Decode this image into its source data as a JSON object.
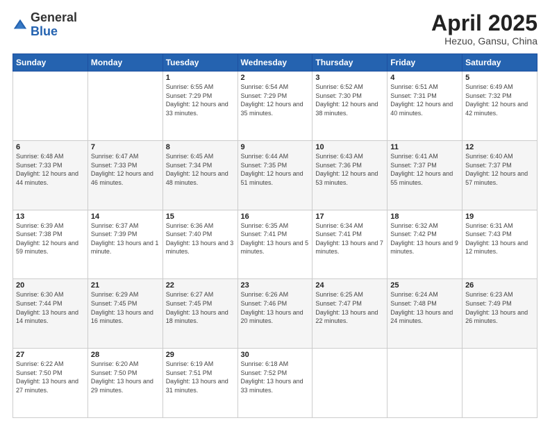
{
  "header": {
    "logo_general": "General",
    "logo_blue": "Blue",
    "title": "April 2025",
    "subtitle": "Hezuo, Gansu, China"
  },
  "weekdays": [
    "Sunday",
    "Monday",
    "Tuesday",
    "Wednesday",
    "Thursday",
    "Friday",
    "Saturday"
  ],
  "weeks": [
    [
      {
        "day": "",
        "sunrise": "",
        "sunset": "",
        "daylight": ""
      },
      {
        "day": "",
        "sunrise": "",
        "sunset": "",
        "daylight": ""
      },
      {
        "day": "1",
        "sunrise": "Sunrise: 6:55 AM",
        "sunset": "Sunset: 7:29 PM",
        "daylight": "Daylight: 12 hours and 33 minutes."
      },
      {
        "day": "2",
        "sunrise": "Sunrise: 6:54 AM",
        "sunset": "Sunset: 7:29 PM",
        "daylight": "Daylight: 12 hours and 35 minutes."
      },
      {
        "day": "3",
        "sunrise": "Sunrise: 6:52 AM",
        "sunset": "Sunset: 7:30 PM",
        "daylight": "Daylight: 12 hours and 38 minutes."
      },
      {
        "day": "4",
        "sunrise": "Sunrise: 6:51 AM",
        "sunset": "Sunset: 7:31 PM",
        "daylight": "Daylight: 12 hours and 40 minutes."
      },
      {
        "day": "5",
        "sunrise": "Sunrise: 6:49 AM",
        "sunset": "Sunset: 7:32 PM",
        "daylight": "Daylight: 12 hours and 42 minutes."
      }
    ],
    [
      {
        "day": "6",
        "sunrise": "Sunrise: 6:48 AM",
        "sunset": "Sunset: 7:33 PM",
        "daylight": "Daylight: 12 hours and 44 minutes."
      },
      {
        "day": "7",
        "sunrise": "Sunrise: 6:47 AM",
        "sunset": "Sunset: 7:33 PM",
        "daylight": "Daylight: 12 hours and 46 minutes."
      },
      {
        "day": "8",
        "sunrise": "Sunrise: 6:45 AM",
        "sunset": "Sunset: 7:34 PM",
        "daylight": "Daylight: 12 hours and 48 minutes."
      },
      {
        "day": "9",
        "sunrise": "Sunrise: 6:44 AM",
        "sunset": "Sunset: 7:35 PM",
        "daylight": "Daylight: 12 hours and 51 minutes."
      },
      {
        "day": "10",
        "sunrise": "Sunrise: 6:43 AM",
        "sunset": "Sunset: 7:36 PM",
        "daylight": "Daylight: 12 hours and 53 minutes."
      },
      {
        "day": "11",
        "sunrise": "Sunrise: 6:41 AM",
        "sunset": "Sunset: 7:37 PM",
        "daylight": "Daylight: 12 hours and 55 minutes."
      },
      {
        "day": "12",
        "sunrise": "Sunrise: 6:40 AM",
        "sunset": "Sunset: 7:37 PM",
        "daylight": "Daylight: 12 hours and 57 minutes."
      }
    ],
    [
      {
        "day": "13",
        "sunrise": "Sunrise: 6:39 AM",
        "sunset": "Sunset: 7:38 PM",
        "daylight": "Daylight: 12 hours and 59 minutes."
      },
      {
        "day": "14",
        "sunrise": "Sunrise: 6:37 AM",
        "sunset": "Sunset: 7:39 PM",
        "daylight": "Daylight: 13 hours and 1 minute."
      },
      {
        "day": "15",
        "sunrise": "Sunrise: 6:36 AM",
        "sunset": "Sunset: 7:40 PM",
        "daylight": "Daylight: 13 hours and 3 minutes."
      },
      {
        "day": "16",
        "sunrise": "Sunrise: 6:35 AM",
        "sunset": "Sunset: 7:41 PM",
        "daylight": "Daylight: 13 hours and 5 minutes."
      },
      {
        "day": "17",
        "sunrise": "Sunrise: 6:34 AM",
        "sunset": "Sunset: 7:41 PM",
        "daylight": "Daylight: 13 hours and 7 minutes."
      },
      {
        "day": "18",
        "sunrise": "Sunrise: 6:32 AM",
        "sunset": "Sunset: 7:42 PM",
        "daylight": "Daylight: 13 hours and 9 minutes."
      },
      {
        "day": "19",
        "sunrise": "Sunrise: 6:31 AM",
        "sunset": "Sunset: 7:43 PM",
        "daylight": "Daylight: 13 hours and 12 minutes."
      }
    ],
    [
      {
        "day": "20",
        "sunrise": "Sunrise: 6:30 AM",
        "sunset": "Sunset: 7:44 PM",
        "daylight": "Daylight: 13 hours and 14 minutes."
      },
      {
        "day": "21",
        "sunrise": "Sunrise: 6:29 AM",
        "sunset": "Sunset: 7:45 PM",
        "daylight": "Daylight: 13 hours and 16 minutes."
      },
      {
        "day": "22",
        "sunrise": "Sunrise: 6:27 AM",
        "sunset": "Sunset: 7:45 PM",
        "daylight": "Daylight: 13 hours and 18 minutes."
      },
      {
        "day": "23",
        "sunrise": "Sunrise: 6:26 AM",
        "sunset": "Sunset: 7:46 PM",
        "daylight": "Daylight: 13 hours and 20 minutes."
      },
      {
        "day": "24",
        "sunrise": "Sunrise: 6:25 AM",
        "sunset": "Sunset: 7:47 PM",
        "daylight": "Daylight: 13 hours and 22 minutes."
      },
      {
        "day": "25",
        "sunrise": "Sunrise: 6:24 AM",
        "sunset": "Sunset: 7:48 PM",
        "daylight": "Daylight: 13 hours and 24 minutes."
      },
      {
        "day": "26",
        "sunrise": "Sunrise: 6:23 AM",
        "sunset": "Sunset: 7:49 PM",
        "daylight": "Daylight: 13 hours and 26 minutes."
      }
    ],
    [
      {
        "day": "27",
        "sunrise": "Sunrise: 6:22 AM",
        "sunset": "Sunset: 7:50 PM",
        "daylight": "Daylight: 13 hours and 27 minutes."
      },
      {
        "day": "28",
        "sunrise": "Sunrise: 6:20 AM",
        "sunset": "Sunset: 7:50 PM",
        "daylight": "Daylight: 13 hours and 29 minutes."
      },
      {
        "day": "29",
        "sunrise": "Sunrise: 6:19 AM",
        "sunset": "Sunset: 7:51 PM",
        "daylight": "Daylight: 13 hours and 31 minutes."
      },
      {
        "day": "30",
        "sunrise": "Sunrise: 6:18 AM",
        "sunset": "Sunset: 7:52 PM",
        "daylight": "Daylight: 13 hours and 33 minutes."
      },
      {
        "day": "",
        "sunrise": "",
        "sunset": "",
        "daylight": ""
      },
      {
        "day": "",
        "sunrise": "",
        "sunset": "",
        "daylight": ""
      },
      {
        "day": "",
        "sunrise": "",
        "sunset": "",
        "daylight": ""
      }
    ]
  ]
}
